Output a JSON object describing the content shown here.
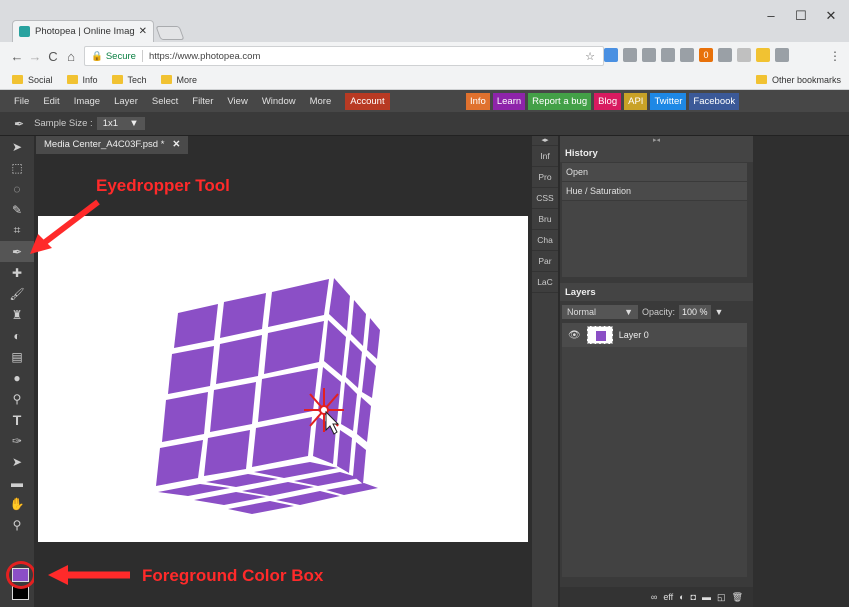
{
  "browser": {
    "tab_title": "Photopea | Online Image",
    "tab_close": "✕",
    "window_controls": [
      "–",
      "☐",
      "✕"
    ],
    "nav": {
      "back": "←",
      "forward": "→",
      "reload": "C",
      "home": "⌂"
    },
    "lock": "🔒",
    "secure_label": "Secure",
    "url": "https://www.photopea.com",
    "star": "☆",
    "menu_dots": "⋮",
    "extensions": [
      {
        "label": "",
        "color": "#4a90e2"
      },
      {
        "label": "",
        "color": "#9aa0a6"
      },
      {
        "label": "",
        "color": "#9aa0a6"
      },
      {
        "label": "",
        "color": "#9aa0a6"
      },
      {
        "label": "",
        "color": "#9aa0a6"
      },
      {
        "label": "0",
        "color": "#e8710a"
      },
      {
        "label": "",
        "color": "#9aa0a6"
      },
      {
        "label": "",
        "color": "#c0c0c0"
      },
      {
        "label": "",
        "color": "#f1c232"
      },
      {
        "label": "",
        "color": "#9aa0a6"
      }
    ],
    "bookmarks": [
      "Social",
      "Info",
      "Tech",
      "More"
    ],
    "other_bookmarks": "Other bookmarks"
  },
  "app": {
    "menu": [
      "File",
      "Edit",
      "Image",
      "Layer",
      "Select",
      "Filter",
      "View",
      "Window",
      "More"
    ],
    "account": "Account",
    "pills": [
      {
        "label": "Info",
        "color": "#e0712e"
      },
      {
        "label": "Learn",
        "color": "#8e24aa"
      },
      {
        "label": "Report a bug",
        "color": "#43a047"
      },
      {
        "label": "Blog",
        "color": "#d81b60"
      },
      {
        "label": "API",
        "color": "#c9a227"
      },
      {
        "label": "Twitter",
        "color": "#1e88e5"
      },
      {
        "label": "Facebook",
        "color": "#3b5998"
      }
    ],
    "options": {
      "sample_size_label": "Sample Size :",
      "sample_size_value": "1x1",
      "dropdown_arrow": "▼"
    },
    "document_tab": "Media Center_A4C03F.psd *",
    "document_tab_close": "✕",
    "mini_tabs": [
      "Inf",
      "Pro",
      "CSS",
      "Bru",
      "Cha",
      "Par",
      "LaC"
    ],
    "history": {
      "title": "History",
      "items": [
        "Open",
        "Hue / Saturation"
      ]
    },
    "layers": {
      "title": "Layers",
      "blend_mode": "Normal",
      "opacity_label": "Opacity:",
      "opacity_value": "100 %",
      "layer_name": "Layer 0",
      "footer_icons": [
        "∞",
        "eff",
        "◐",
        "◘",
        "▬",
        "◱",
        "🗑"
      ]
    },
    "foreground_color": "#8b4fc6",
    "background_color": "#000000"
  },
  "annotations": {
    "eyedropper_label": "Eyedropper Tool",
    "fg_label": "Foreground Color Box",
    "color": "#ff2a2a"
  }
}
